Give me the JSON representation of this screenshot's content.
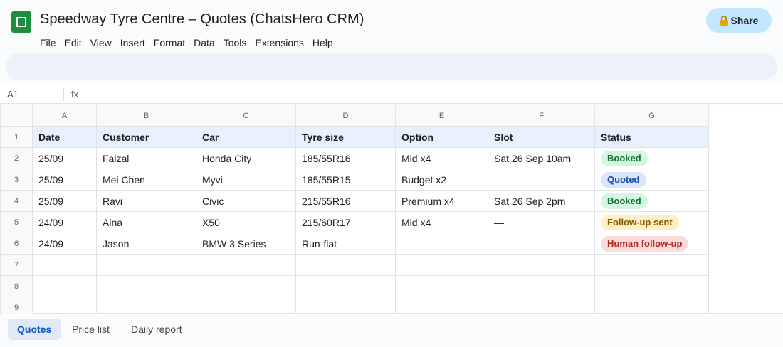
{
  "app": {
    "title": "Speedway Tyre Centre – Quotes (ChatsHero CRM)",
    "share_label": "Share",
    "logo_icon": "sheets-logo-icon",
    "lock_icon": "lock-icon"
  },
  "menu": [
    "File",
    "Edit",
    "View",
    "Insert",
    "Format",
    "Data",
    "Tools",
    "Extensions",
    "Help"
  ],
  "formula_bar": {
    "cell_ref": "A1",
    "fx_label": "fx",
    "value": ""
  },
  "columns": [
    "A",
    "B",
    "C",
    "D",
    "E",
    "F",
    "G"
  ],
  "row_numbers": [
    "1",
    "2",
    "3",
    "4",
    "5",
    "6",
    "7",
    "8",
    "9"
  ],
  "headers": [
    "Date",
    "Customer",
    "Car",
    "Tyre size",
    "Option",
    "Slot",
    "Status"
  ],
  "rows": [
    {
      "date": "25/09",
      "customer": "Faizal",
      "car": "Honda City",
      "tyre_size": "185/55R16",
      "option": "Mid x4",
      "slot": "Sat 26 Sep 10am",
      "status": "Booked",
      "status_kind": "booked"
    },
    {
      "date": "25/09",
      "customer": "Mei Chen",
      "car": "Myvi",
      "tyre_size": "185/55R15",
      "option": "Budget x2",
      "slot": "—",
      "status": "Quoted",
      "status_kind": "quoted"
    },
    {
      "date": "25/09",
      "customer": "Ravi",
      "car": "Civic",
      "tyre_size": "215/55R16",
      "option": "Premium x4",
      "slot": "Sat 26 Sep 2pm",
      "status": "Booked",
      "status_kind": "booked"
    },
    {
      "date": "24/09",
      "customer": "Aina",
      "car": "X50",
      "tyre_size": "215/60R17",
      "option": "Mid x4",
      "slot": "—",
      "status": "Follow-up sent",
      "status_kind": "followup"
    },
    {
      "date": "24/09",
      "customer": "Jason",
      "car": "BMW 3 Series",
      "tyre_size": "Run-flat",
      "option": "—",
      "slot": "—",
      "status": "Human follow-up",
      "status_kind": "human"
    }
  ],
  "status_colors": {
    "booked": {
      "bg": "#d4f5e2",
      "fg": "#137333"
    },
    "quoted": {
      "bg": "#dbe6fc",
      "fg": "#1a47b0"
    },
    "followup": {
      "bg": "#fdf0c4",
      "fg": "#8a5a00"
    },
    "human": {
      "bg": "#fbdcdc",
      "fg": "#b3261e"
    }
  },
  "sheet_tabs": [
    {
      "label": "Quotes",
      "active": true
    },
    {
      "label": "Price list",
      "active": false
    },
    {
      "label": "Daily report",
      "active": false
    }
  ],
  "colors": {
    "accent": "#0b57d0",
    "share_bg": "#c2e7ff",
    "header_row_bg": "#e8f0fe",
    "logo": "#1e8e3e"
  }
}
